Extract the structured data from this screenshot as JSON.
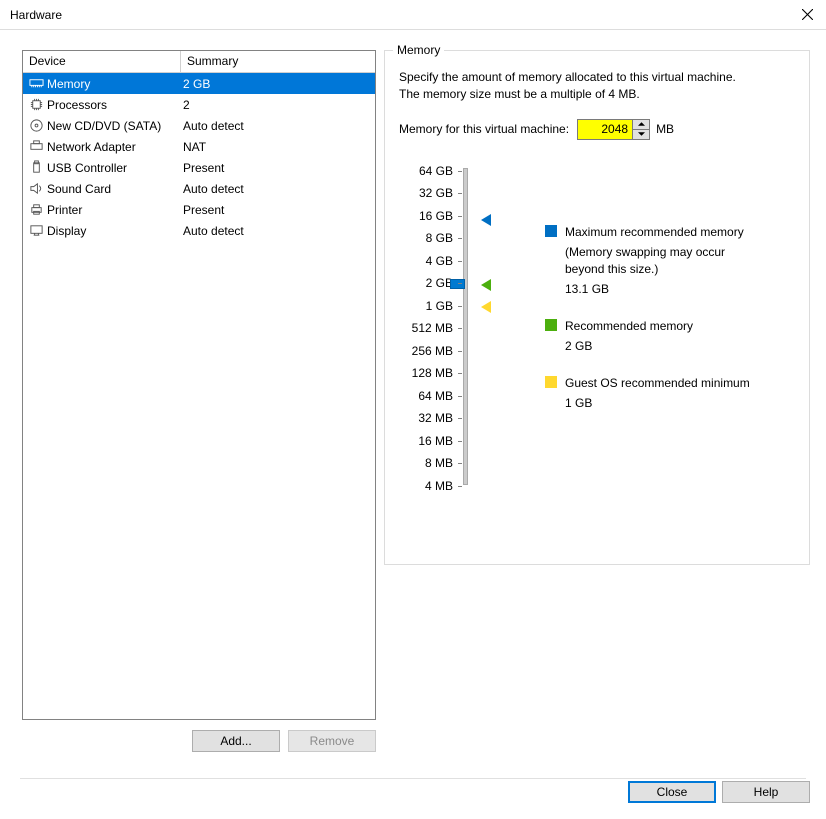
{
  "window": {
    "title": "Hardware"
  },
  "table": {
    "header_device": "Device",
    "header_summary": "Summary",
    "rows": [
      {
        "device": "Memory",
        "summary": "2 GB"
      },
      {
        "device": "Processors",
        "summary": "2"
      },
      {
        "device": "New CD/DVD (SATA)",
        "summary": "Auto detect"
      },
      {
        "device": "Network Adapter",
        "summary": "NAT"
      },
      {
        "device": "USB Controller",
        "summary": "Present"
      },
      {
        "device": "Sound Card",
        "summary": "Auto detect"
      },
      {
        "device": "Printer",
        "summary": "Present"
      },
      {
        "device": "Display",
        "summary": "Auto detect"
      }
    ]
  },
  "left_buttons": {
    "add": "Add...",
    "remove": "Remove"
  },
  "memory": {
    "legend": "Memory",
    "desc1": "Specify the amount of memory allocated to this virtual machine.",
    "desc2": "The memory size must be a multiple of 4 MB.",
    "input_label": "Memory for this virtual machine:",
    "unit": "MB",
    "value": "2048",
    "ticks": [
      "64 GB",
      "32 GB",
      "16 GB",
      "8 GB",
      "4 GB",
      "2 GB",
      "1 GB",
      "512 MB",
      "256 MB",
      "128 MB",
      "64 MB",
      "32 MB",
      "16 MB",
      "8 MB",
      "4 MB"
    ],
    "legend_items": {
      "max_label": "Maximum recommended memory",
      "max_note": "(Memory swapping may occur beyond this size.)",
      "max_val": "13.1 GB",
      "rec_label": "Recommended memory",
      "rec_val": "2 GB",
      "min_label": "Guest OS recommended minimum",
      "min_val": "1 GB"
    }
  },
  "bottom": {
    "close": "Close",
    "help": "Help"
  }
}
